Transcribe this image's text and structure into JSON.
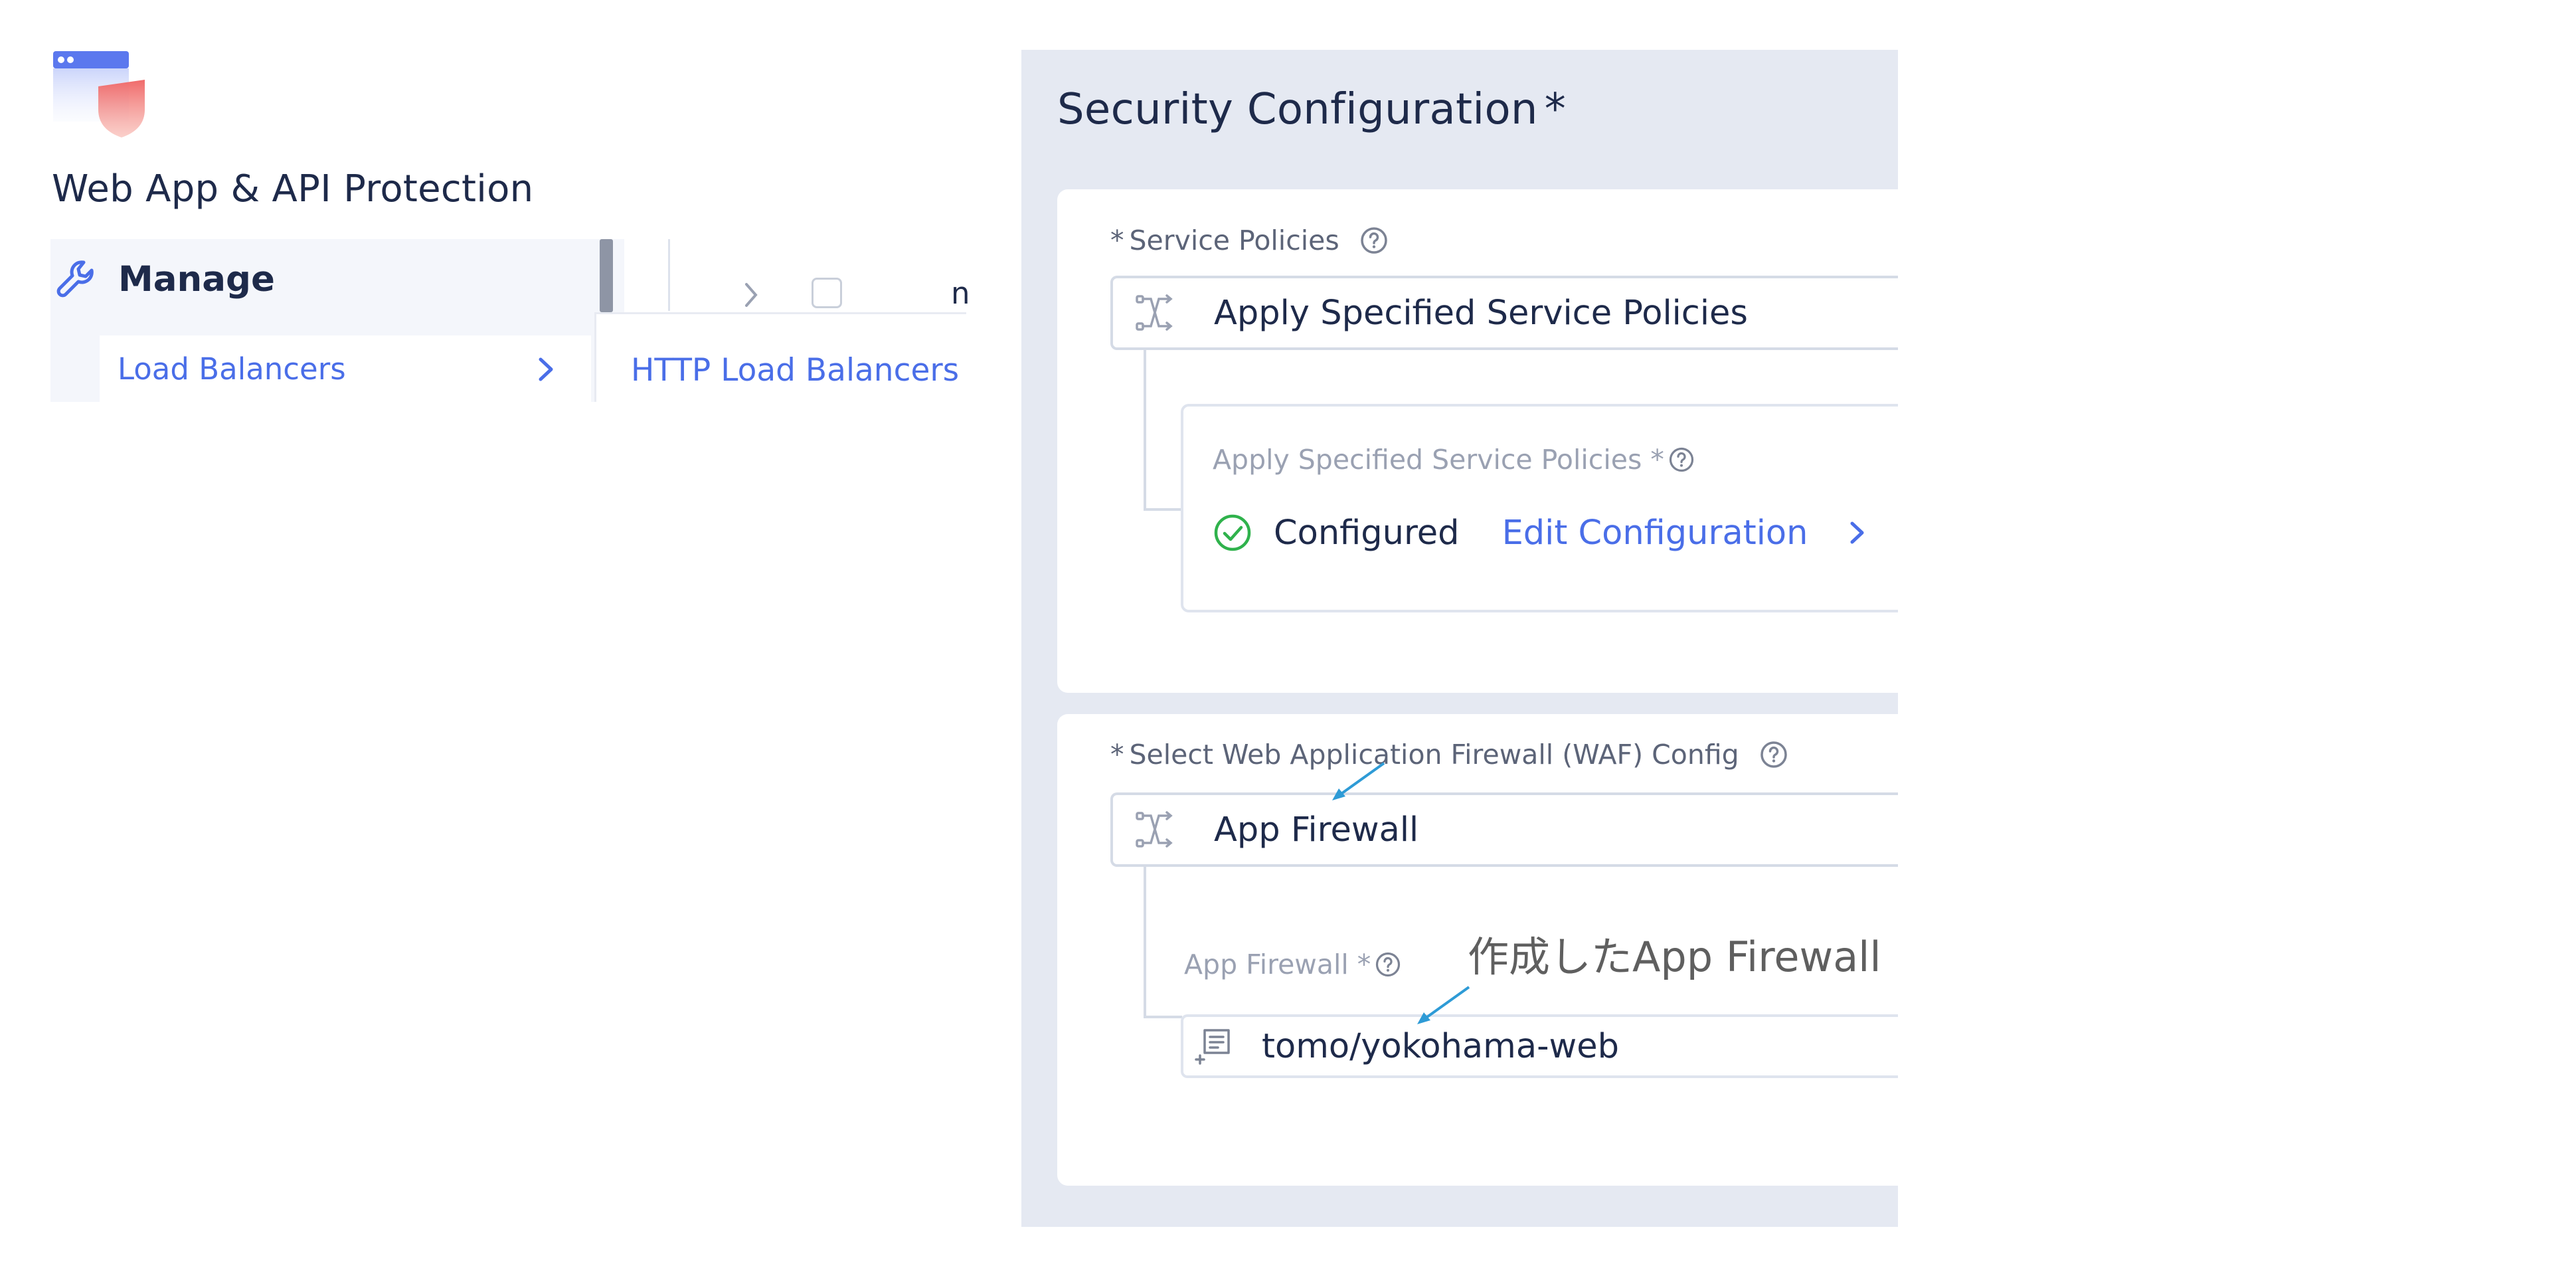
{
  "app": {
    "title": "Web App & API Protection",
    "logo_icon": "web-app-shield-logo"
  },
  "nav": {
    "section_label": "Manage",
    "section_icon": "wrench-icon",
    "item_label": "Load Balancers",
    "peek_text": "n",
    "submenu_label": "HTTP Load Balancers"
  },
  "security": {
    "title": "Security Configuration",
    "required_mark": "*",
    "service_policies": {
      "required_mark": "*",
      "label": "Service Policies",
      "selected": "Apply Specified Service Policies",
      "sub_label": "Apply Specified Service Policies *",
      "status": "Configured",
      "edit_link": "Edit Configuration"
    },
    "waf": {
      "required_mark": "*",
      "label": "Select Web Application Firewall (WAF) Config",
      "selected": "App Firewall",
      "sub_label": "App Firewall *",
      "value": "tomo/yokohama-web"
    }
  },
  "annotation": {
    "text": "作成したApp Firewall",
    "color": "#2e9bd6"
  },
  "colors": {
    "accent": "#4a6ee8",
    "success": "#2fb24c",
    "panel_bg": "#e5e9f2",
    "text_primary": "#1e2a4a"
  }
}
